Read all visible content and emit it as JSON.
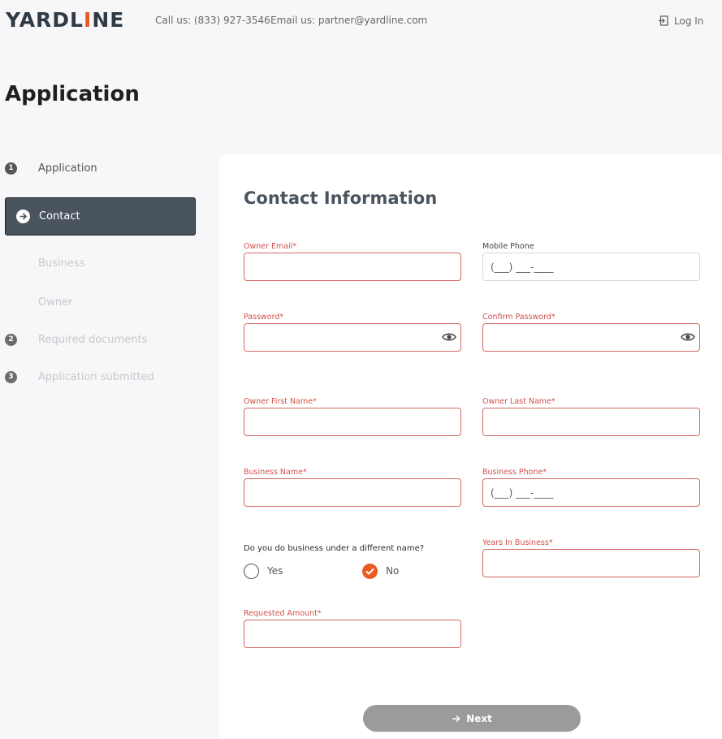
{
  "header": {
    "logo_left": "YARDL",
    "logo_accent": "I",
    "logo_right": "NE",
    "call": "Call us: (833) 927-3546",
    "email": "Email us: partner@yardline.com",
    "login": "Log In"
  },
  "page_title": "Application",
  "sidebar": {
    "steps": [
      {
        "num": "1",
        "label": "Application"
      },
      {
        "num": "2",
        "label": "Required documents"
      },
      {
        "num": "3",
        "label": "Application submitted"
      }
    ],
    "active": "Contact",
    "substeps": [
      "Business",
      "Owner"
    ]
  },
  "form": {
    "title": "Contact Information",
    "owner_email": {
      "label": "Owner Email*",
      "value": ""
    },
    "mobile_phone": {
      "label": "Mobile Phone",
      "placeholder": "(___) ___-____"
    },
    "password": {
      "label": "Password*",
      "value": ""
    },
    "confirm_password": {
      "label": "Confirm Password*",
      "value": ""
    },
    "first_name": {
      "label": "Owner First Name*",
      "value": ""
    },
    "last_name": {
      "label": "Owner Last Name*",
      "value": ""
    },
    "business_name": {
      "label": "Business Name*",
      "value": ""
    },
    "business_phone": {
      "label": "Business Phone*",
      "placeholder": "(___) ___-____"
    },
    "dba_question": "Do you do business under a different name?",
    "dba_yes": "Yes",
    "dba_no": "No",
    "dba_selected": "No",
    "years_in_business": {
      "label": "Years In Business*",
      "value": ""
    },
    "requested_amount": {
      "label": "Requested Amount*",
      "value": ""
    },
    "next": "Next"
  },
  "colors": {
    "accent": "#ea5b22",
    "required_label": "#d0524d",
    "active_step_bg": "#4a545e",
    "button_disabled": "#9b9b9b"
  }
}
